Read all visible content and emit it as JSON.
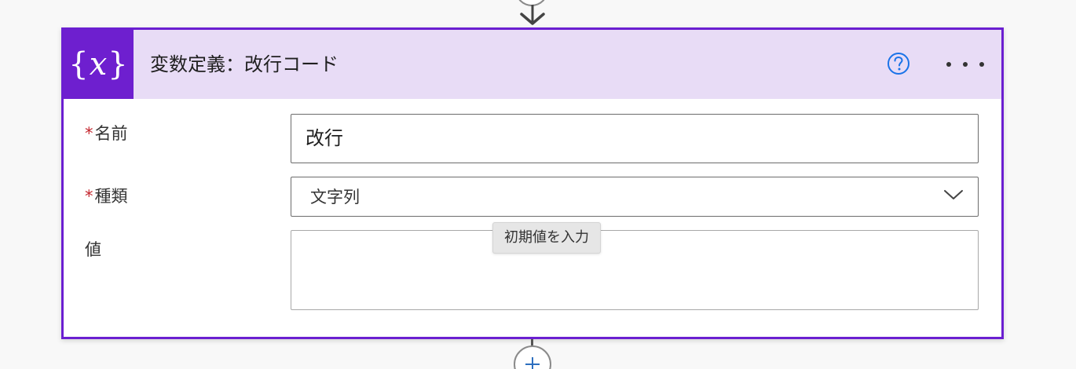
{
  "card": {
    "title": "変数定義：改行コード",
    "icon": "variable-braces-icon",
    "accent_color": "#6e1fcf",
    "header_bg": "#e8dcf6",
    "help_icon": "question-circle-icon",
    "more_icon": "ellipsis-icon"
  },
  "form": {
    "name": {
      "required_mark": "*",
      "label": "名前",
      "value": "改行"
    },
    "type": {
      "required_mark": "*",
      "label": "種類",
      "selected": "文字列"
    },
    "value": {
      "label": "値",
      "value": "",
      "placeholder_tooltip": "初期値を入力"
    }
  },
  "connectors": {
    "top_icon": "arrow-down-icon",
    "bottom_icon": "plus-icon"
  }
}
